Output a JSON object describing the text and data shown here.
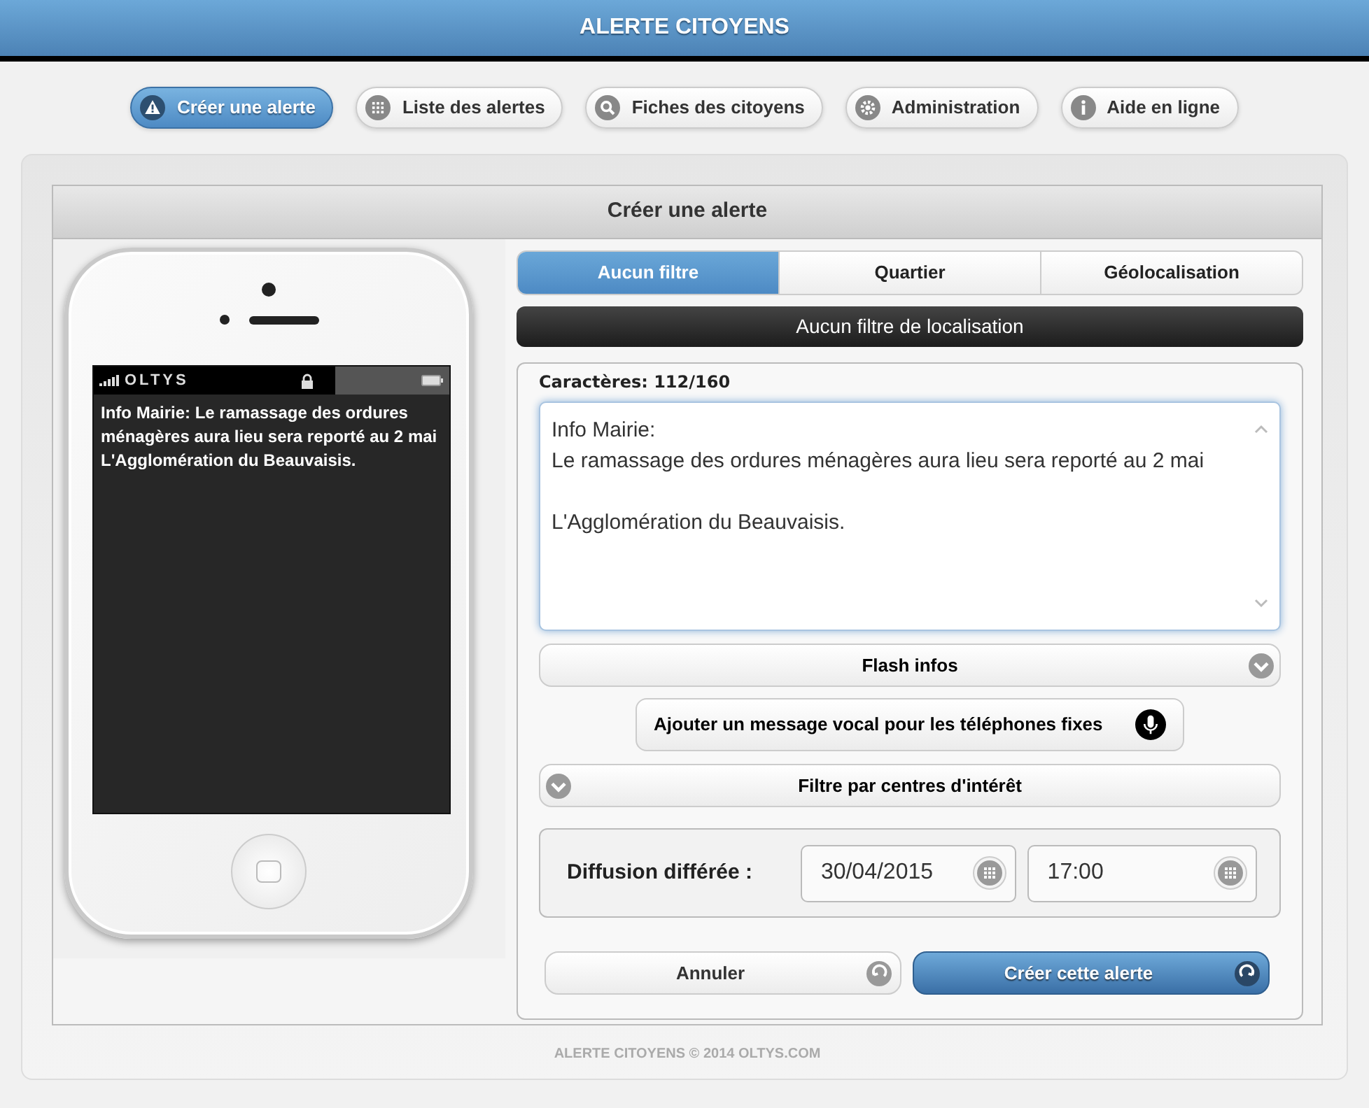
{
  "header": {
    "title": "ALERTE CITOYENS"
  },
  "nav": [
    {
      "label": "Créer une alerte",
      "selected": true
    },
    {
      "label": "Liste des alertes",
      "selected": false
    },
    {
      "label": "Fiches des citoyens",
      "selected": false
    },
    {
      "label": "Administration",
      "selected": false
    },
    {
      "label": "Aide en ligne",
      "selected": false
    }
  ],
  "panel": {
    "title": "Créer une alerte"
  },
  "phone": {
    "carrier": "OLTYS",
    "message_lines": [
      "Info Mairie: Le ramassage des ordures",
      "ménagères aura lieu sera reporté au 2 mai",
      "L'Agglomération du Beauvaisis."
    ]
  },
  "tabs": [
    {
      "label": "Aucun filtre",
      "selected": true
    },
    {
      "label": "Quartier",
      "selected": false
    },
    {
      "label": "Géolocalisation",
      "selected": false
    }
  ],
  "filter_bar": "Aucun filtre de localisation",
  "counter": "Caractères: 112/160",
  "message": {
    "paragraphs": [
      [
        "Info Mairie:",
        "Le ramassage des ordures ménagères aura lieu sera reporté au 2 mai"
      ],
      [
        "L'Agglomération du Beauvaisis."
      ]
    ]
  },
  "sections": [
    {
      "kind": "trailing",
      "label": "Flash infos",
      "expanded": false
    },
    {
      "kind": "voice",
      "label": "Ajouter un message vocal pour les téléphones fixes"
    },
    {
      "kind": "leading",
      "label": "Filtre par centres d'intérêt",
      "expanded": false
    }
  ],
  "schedule": {
    "label": "Diffusion différée :",
    "date": "30/04/2015",
    "time": "17:00"
  },
  "buttons": [
    {
      "kind": "secondary",
      "label": "Annuler"
    },
    {
      "kind": "primary",
      "label": "Créer cette alerte"
    }
  ],
  "footer": "ALERTE CITOYENS © 2014 OLTYS.COM"
}
